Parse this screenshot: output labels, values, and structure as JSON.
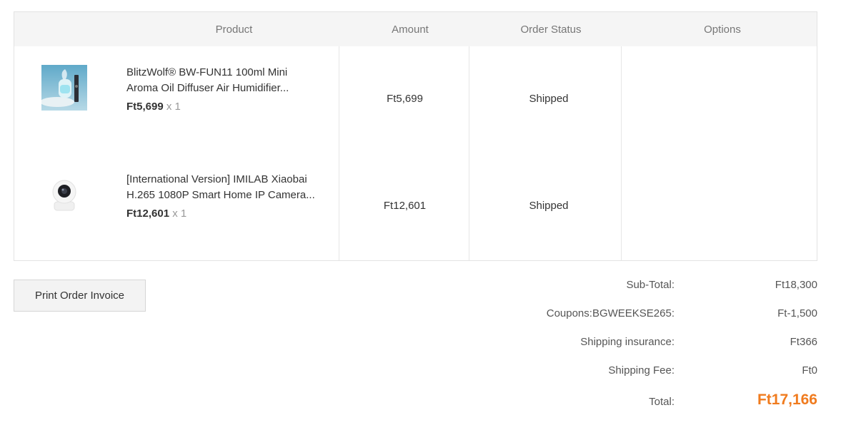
{
  "table": {
    "headers": [
      "Product",
      "Amount",
      "Order Status",
      "Options"
    ],
    "rows": [
      {
        "name_line1": "BlitzWolf® BW-FUN11 100ml Mini",
        "name_line2": "Aroma Oil Diffuser Air Humidifier...",
        "price": "Ft5,699",
        "qty": "x 1",
        "amount": "Ft5,699",
        "status": "Shipped",
        "thumb_icon": "humidifier-image"
      },
      {
        "name_line1": "[International Version] IMILAB Xiaobai",
        "name_line2": "H.265 1080P Smart Home IP Camera...",
        "price": "Ft12,601",
        "qty": "x 1",
        "amount": "Ft12,601",
        "status": "Shipped",
        "thumb_icon": "ip-camera-image"
      }
    ]
  },
  "actions": {
    "print_invoice": "Print Order Invoice"
  },
  "summary": {
    "subtotal_label": "Sub-Total:",
    "subtotal_value": "Ft18,300",
    "coupon_label": "Coupons:BGWEEKSE265:",
    "coupon_value": "Ft-1,500",
    "insurance_label": "Shipping insurance:",
    "insurance_value": "Ft366",
    "shipping_label": "Shipping Fee:",
    "shipping_value": "Ft0",
    "total_label": "Total:",
    "total_value": "Ft17,166"
  },
  "colors": {
    "accent": "#f07b1e",
    "header_bg": "#f5f5f5",
    "border": "#e3e3e3"
  }
}
